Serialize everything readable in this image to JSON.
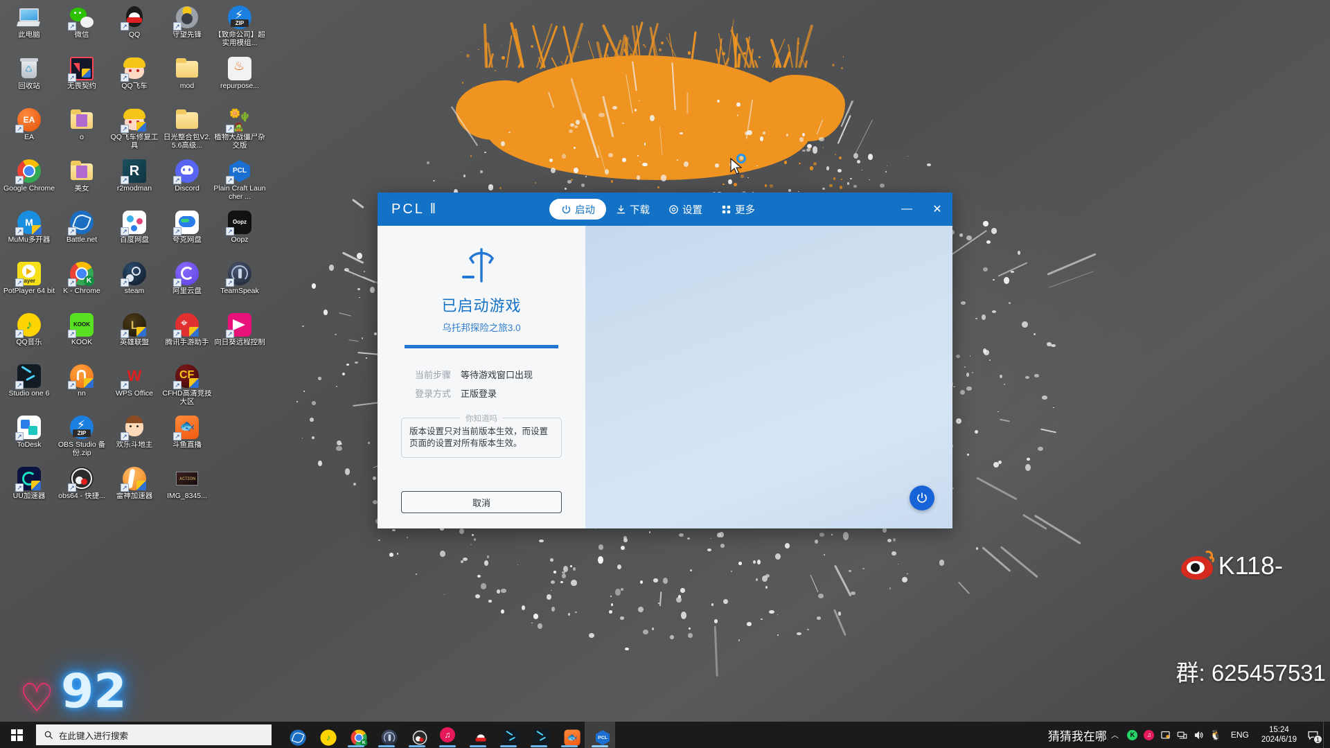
{
  "desktop": {
    "icons": [
      {
        "label": "此电脑",
        "icon": "this-pc-icon",
        "shortcut": false,
        "kind": "pc"
      },
      {
        "label": "微信",
        "icon": "wechat-icon",
        "shortcut": true,
        "kind": "wechat"
      },
      {
        "label": "QQ",
        "icon": "qq-icon",
        "shortcut": true,
        "kind": "qq"
      },
      {
        "label": "守望先锋",
        "icon": "overwatch-icon",
        "shortcut": true,
        "kind": "overwatch"
      },
      {
        "label": "【致命公司】超实用模组...",
        "icon": "zip-archive-icon",
        "shortcut": false,
        "kind": "zip"
      },
      {
        "label": "回收站",
        "icon": "recycle-bin-icon",
        "shortcut": false,
        "kind": "bin"
      },
      {
        "label": "无畏契约",
        "icon": "valorant-icon",
        "shortcut": true,
        "kind": "valorant"
      },
      {
        "label": "QQ飞车",
        "icon": "qq-speed-icon",
        "shortcut": true,
        "kind": "speed"
      },
      {
        "label": "mod",
        "icon": "folder-icon",
        "shortcut": false,
        "kind": "folder"
      },
      {
        "label": "repurpose...",
        "icon": "java-jar-icon",
        "shortcut": false,
        "kind": "java"
      },
      {
        "label": "EA",
        "icon": "ea-icon",
        "shortcut": true,
        "kind": "ea"
      },
      {
        "label": "o",
        "icon": "folder-picture-icon",
        "shortcut": false,
        "kind": "folderpic"
      },
      {
        "label": "QQ飞车修复工具",
        "icon": "qq-speed-repair-icon",
        "shortcut": true,
        "kind": "speed2"
      },
      {
        "label": "日光整合包V2.5.6高级...",
        "icon": "folder-icon",
        "shortcut": false,
        "kind": "folder"
      },
      {
        "label": "植物大战僵尸杂交版",
        "icon": "pvz-icon",
        "shortcut": true,
        "kind": "pvz"
      },
      {
        "label": "Google Chrome",
        "icon": "chrome-icon",
        "shortcut": true,
        "kind": "chrome"
      },
      {
        "label": "美女",
        "icon": "folder-picture-icon",
        "shortcut": false,
        "kind": "folderpic"
      },
      {
        "label": "r2modman",
        "icon": "r2modman-icon",
        "shortcut": true,
        "kind": "r2"
      },
      {
        "label": "Discord",
        "icon": "discord-icon",
        "shortcut": true,
        "kind": "discord"
      },
      {
        "label": "Plain Craft Launcher ...",
        "icon": "pcl-icon",
        "shortcut": true,
        "kind": "pcl"
      },
      {
        "label": "MuMu多开器",
        "icon": "mumu-icon",
        "shortcut": true,
        "kind": "mumu"
      },
      {
        "label": "Battle.net",
        "icon": "battlenet-icon",
        "shortcut": true,
        "kind": "battlenet"
      },
      {
        "label": "百度网盘",
        "icon": "baidu-netdisk-icon",
        "shortcut": true,
        "kind": "baidu"
      },
      {
        "label": "夸克网盘",
        "icon": "quark-netdisk-icon",
        "shortcut": true,
        "kind": "quark"
      },
      {
        "label": "Oopz",
        "icon": "oopz-icon",
        "shortcut": true,
        "kind": "oopz"
      },
      {
        "label": "PotPlayer 64 bit",
        "icon": "potplayer-icon",
        "shortcut": true,
        "kind": "potplayer"
      },
      {
        "label": "K - Chrome",
        "icon": "chrome-k-icon",
        "shortcut": true,
        "kind": "chromek"
      },
      {
        "label": "steam",
        "icon": "steam-icon",
        "shortcut": true,
        "kind": "steam"
      },
      {
        "label": "阿里云盘",
        "icon": "aliyun-drive-icon",
        "shortcut": true,
        "kind": "aliyun"
      },
      {
        "label": "TeamSpeak",
        "icon": "teamspeak-icon",
        "shortcut": true,
        "kind": "teamspeak"
      },
      {
        "label": "QQ音乐",
        "icon": "qq-music-icon",
        "shortcut": true,
        "kind": "qqmusic"
      },
      {
        "label": "KOOK",
        "icon": "kook-icon",
        "shortcut": true,
        "kind": "kook"
      },
      {
        "label": "英雄联盟",
        "icon": "league-of-legends-icon",
        "shortcut": true,
        "kind": "lol"
      },
      {
        "label": "腾讯手游助手",
        "icon": "tencent-gamebuddy-icon",
        "shortcut": true,
        "kind": "gamebuddy"
      },
      {
        "label": "向日葵远程控制",
        "icon": "sunlogin-icon",
        "shortcut": true,
        "kind": "sunlogin"
      },
      {
        "label": "Studio one 6",
        "icon": "studio-one-icon",
        "shortcut": true,
        "kind": "studioone"
      },
      {
        "label": "nn",
        "icon": "nn-icon",
        "shortcut": true,
        "kind": "nn"
      },
      {
        "label": "WPS Office",
        "icon": "wps-office-icon",
        "shortcut": true,
        "kind": "wps"
      },
      {
        "label": "CFHD高清竞技大区",
        "icon": "cfhd-icon",
        "shortcut": true,
        "kind": "cfhd"
      },
      {
        "label": "",
        "icon": "empty-slot",
        "shortcut": false,
        "kind": "empty"
      },
      {
        "label": "ToDesk",
        "icon": "todesk-icon",
        "shortcut": true,
        "kind": "todesk"
      },
      {
        "label": "OBS Studio 备份.zip",
        "icon": "zip-archive-icon",
        "shortcut": false,
        "kind": "zip"
      },
      {
        "label": "欢乐斗地主",
        "icon": "ddz-icon",
        "shortcut": true,
        "kind": "ddz"
      },
      {
        "label": "斗鱼直播",
        "icon": "douyu-icon",
        "shortcut": true,
        "kind": "douyu"
      },
      {
        "label": "",
        "icon": "empty-slot",
        "shortcut": false,
        "kind": "empty"
      },
      {
        "label": "UU加速器",
        "icon": "uu-booster-icon",
        "shortcut": true,
        "kind": "uu"
      },
      {
        "label": "obs64 - 快捷...",
        "icon": "obs-icon",
        "shortcut": true,
        "kind": "obs"
      },
      {
        "label": "雷神加速器",
        "icon": "leishen-booster-icon",
        "shortcut": true,
        "kind": "leishen"
      },
      {
        "label": "IMG_8345...",
        "icon": "image-thumbnail-icon",
        "shortcut": false,
        "kind": "imgthumb"
      }
    ],
    "neon_heart": "♡",
    "neon_number": "92",
    "weibo_watermark": "K118-",
    "group_watermark": "群: 625457531"
  },
  "pcl_window": {
    "logo": "PCL ǁ",
    "nav": [
      {
        "label": "启动",
        "icon": "power-icon",
        "active": true
      },
      {
        "label": "下载",
        "icon": "download-icon",
        "active": false
      },
      {
        "label": "设置",
        "icon": "gear-icon",
        "active": false
      },
      {
        "label": "更多",
        "icon": "grid-icon",
        "active": false
      }
    ],
    "window_buttons": {
      "minimize": "—",
      "close": "✕"
    },
    "left_panel": {
      "status_title": "已启动游戏",
      "version_name": "乌托邦探险之旅3.0",
      "progress_percent": 100,
      "info": [
        {
          "key": "当前步骤",
          "value": "等待游戏窗口出现"
        },
        {
          "key": "登录方式",
          "value": "正版登录"
        }
      ],
      "tip_legend": "你知道吗",
      "tip_text": "版本设置只对当前版本生效，而设置页面的设置对所有版本生效。",
      "cancel_label": "取消"
    },
    "right_panel": {
      "power_fab_icon": "power-icon"
    }
  },
  "taskbar": {
    "start_icon": "windows-start-icon",
    "search_placeholder": "在此键入进行搜索",
    "search_value": "",
    "search_icon": "search-icon",
    "apps": [
      {
        "name": "battlenet-taskbar-icon",
        "running": false
      },
      {
        "name": "qq-music-taskbar-icon",
        "running": false
      },
      {
        "name": "chrome-k-taskbar-icon",
        "running": true
      },
      {
        "name": "teamspeak-taskbar-icon",
        "running": true
      },
      {
        "name": "obs-taskbar-icon",
        "running": true
      },
      {
        "name": "netease-music-taskbar-icon",
        "running": true
      },
      {
        "name": "qq-taskbar-icon",
        "running": true
      },
      {
        "name": "studio-one-taskbar-icon",
        "running": true
      },
      {
        "name": "studio-one-2-taskbar-icon",
        "running": true
      },
      {
        "name": "douyu-taskbar-icon",
        "running": true
      },
      {
        "name": "pcl-taskbar-icon",
        "running": true,
        "active": true
      }
    ],
    "tray_message": "猜猜我在哪",
    "tray_chevron": "︿",
    "tray_icons": [
      {
        "name": "kook-tray-icon"
      },
      {
        "name": "netease-music-tray-icon"
      },
      {
        "name": "screenshot-tray-icon"
      },
      {
        "name": "network-tray-icon"
      },
      {
        "name": "volume-tray-icon"
      },
      {
        "name": "qq-tray-icon"
      }
    ],
    "language": "ENG",
    "clock_time": "15:24",
    "clock_date": "2024/6/19",
    "action_center_badge": "1",
    "action_center_icon": "notification-icon"
  },
  "colors": {
    "accent_blue": "#1372c6",
    "progress_blue": "#2277d4",
    "fab_blue": "#1664d8",
    "splat_orange": "#ef9421",
    "desktop_gray": "#57585a"
  }
}
